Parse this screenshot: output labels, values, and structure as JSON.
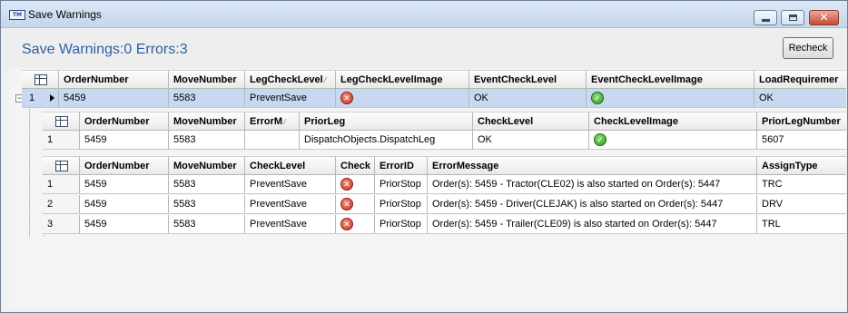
{
  "window": {
    "title": "Save Warnings",
    "icon": "app-logo-icon",
    "minimize_icon": "minimize-icon",
    "maximize_icon": "maximize-icon",
    "close_icon": "close-icon"
  },
  "summary": {
    "text": "Save Warnings:0 Errors:3"
  },
  "recheck_label": "Recheck",
  "main_grid": {
    "columns": [
      "OrderNumber",
      "MoveNumber",
      "LegCheckLevel",
      "LegCheckLevelImage",
      "EventCheckLevel",
      "EventCheckLevelImage",
      "LoadRequiremer"
    ],
    "sort_column": "LegCheckLevel",
    "rows": [
      {
        "rownum": "1",
        "cells": [
          "5459",
          "5583",
          "PreventSave",
          "error",
          "OK",
          "ok",
          "OK"
        ]
      }
    ]
  },
  "leg_grid": {
    "columns": [
      "OrderNumber",
      "MoveNumber",
      "ErrorM",
      "PriorLeg",
      "CheckLevel",
      "CheckLevelImage",
      "PriorLegNumber"
    ],
    "sort_column": "ErrorM",
    "rows": [
      {
        "rownum": "1",
        "cells": [
          "5459",
          "5583",
          "",
          "DispatchObjects.DispatchLeg",
          "OK",
          "ok",
          "5607"
        ]
      }
    ]
  },
  "error_grid": {
    "columns": [
      "OrderNumber",
      "MoveNumber",
      "CheckLevel",
      "Check",
      "ErrorID",
      "ErrorMessage",
      "AssignType"
    ],
    "rows": [
      {
        "rownum": "1",
        "cells": [
          "5459",
          "5583",
          "PreventSave",
          "error",
          "PriorStop",
          "Order(s): 5459 - Tractor(CLE02) is also started on Order(s): 5447",
          "TRC"
        ]
      },
      {
        "rownum": "2",
        "cells": [
          "5459",
          "5583",
          "PreventSave",
          "error",
          "PriorStop",
          "Order(s): 5459 - Driver(CLEJAK) is also started on Order(s): 5447",
          "DRV"
        ]
      },
      {
        "rownum": "3",
        "cells": [
          "5459",
          "5583",
          "PreventSave",
          "error",
          "PriorStop",
          "Order(s): 5459 - Trailer(CLE09) is also started on Order(s): 5447",
          "TRL"
        ]
      }
    ]
  },
  "icons": {
    "error": "error-x-icon",
    "ok": "ok-check-icon",
    "table": "table-layout-icon",
    "sort": "sort-indicator-icon",
    "expander": "collapse-minus-icon",
    "row_pointer": "current-row-arrow-icon"
  },
  "colors": {
    "summary_text": "#2e5fa8",
    "selected_row": "#c6d9f1",
    "error_icon": "#c8321e",
    "ok_icon": "#2f9a22"
  }
}
